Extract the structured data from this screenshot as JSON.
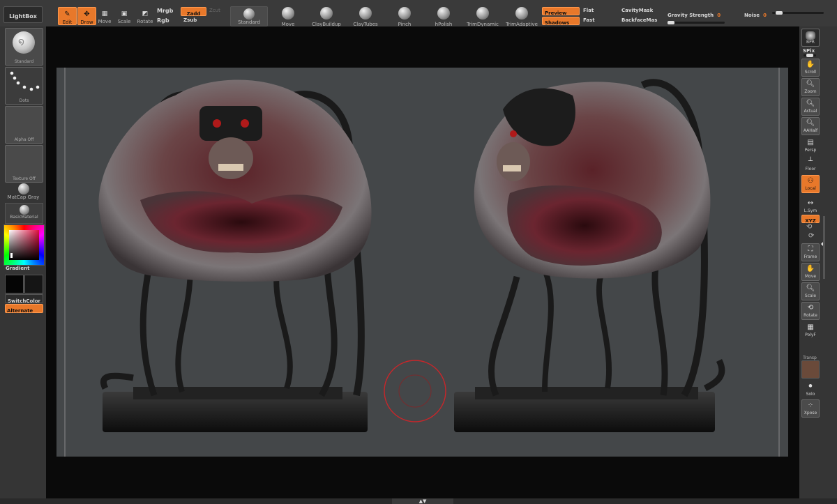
{
  "toolbar": {
    "lightbox": "LightBox",
    "edit": "Edit",
    "draw": "Draw",
    "move": "Move",
    "scale": "Scale",
    "rotate": "Rotate",
    "mrgb": "Mrgb",
    "rgb": "Rgb",
    "zadd": "Zadd",
    "zsub": "Zsub",
    "zcut": "Zcut",
    "active_brush": "Standard",
    "brushes": [
      "Move",
      "ClayBuildup",
      "ClayTubes",
      "Pinch",
      "hPolish",
      "TrimDynamic",
      "TrimAdaptive"
    ],
    "preview": "Preview",
    "shadows": "Shadows",
    "flat": "Flat",
    "fast": "Fast",
    "cavitymask": "CavityMask",
    "backfacemask": "BackfaceMas",
    "gravity_label": "Gravity Strength",
    "gravity_value": "0",
    "gravity_level": 0.0,
    "noise_label": "Noise",
    "noise_value": "0",
    "noise_level": 0.08
  },
  "left_shelf": {
    "brush": "Standard",
    "stroke": "Dots",
    "alpha": "Alpha Off",
    "texture": "Texture Off",
    "matcap": "MatCap Gray",
    "material": "BasicMaterial",
    "gradient": "Gradient",
    "switchcolor": "SwitchColor",
    "alternate": "Alternate"
  },
  "right_shelf": {
    "bpr": "BPR",
    "spix": "SPix",
    "scroll": "Scroll",
    "zoom": "Zoom",
    "actual": "Actual",
    "aahalf": "AAHalf",
    "persp": "Persp",
    "floor": "Floor",
    "local": "Local",
    "lsym": "L.Sym",
    "xyz": "XYZ",
    "frame": "Frame",
    "move": "Move",
    "scale": "Scale",
    "rotate": "Rotate",
    "polyf": "PolyF",
    "transp": "Transp",
    "solo": "Solo",
    "xpose": "Xpose"
  },
  "colors": {
    "accent": "#e8782a",
    "brush_ring": "#c8262a",
    "canvas": "#444749"
  }
}
